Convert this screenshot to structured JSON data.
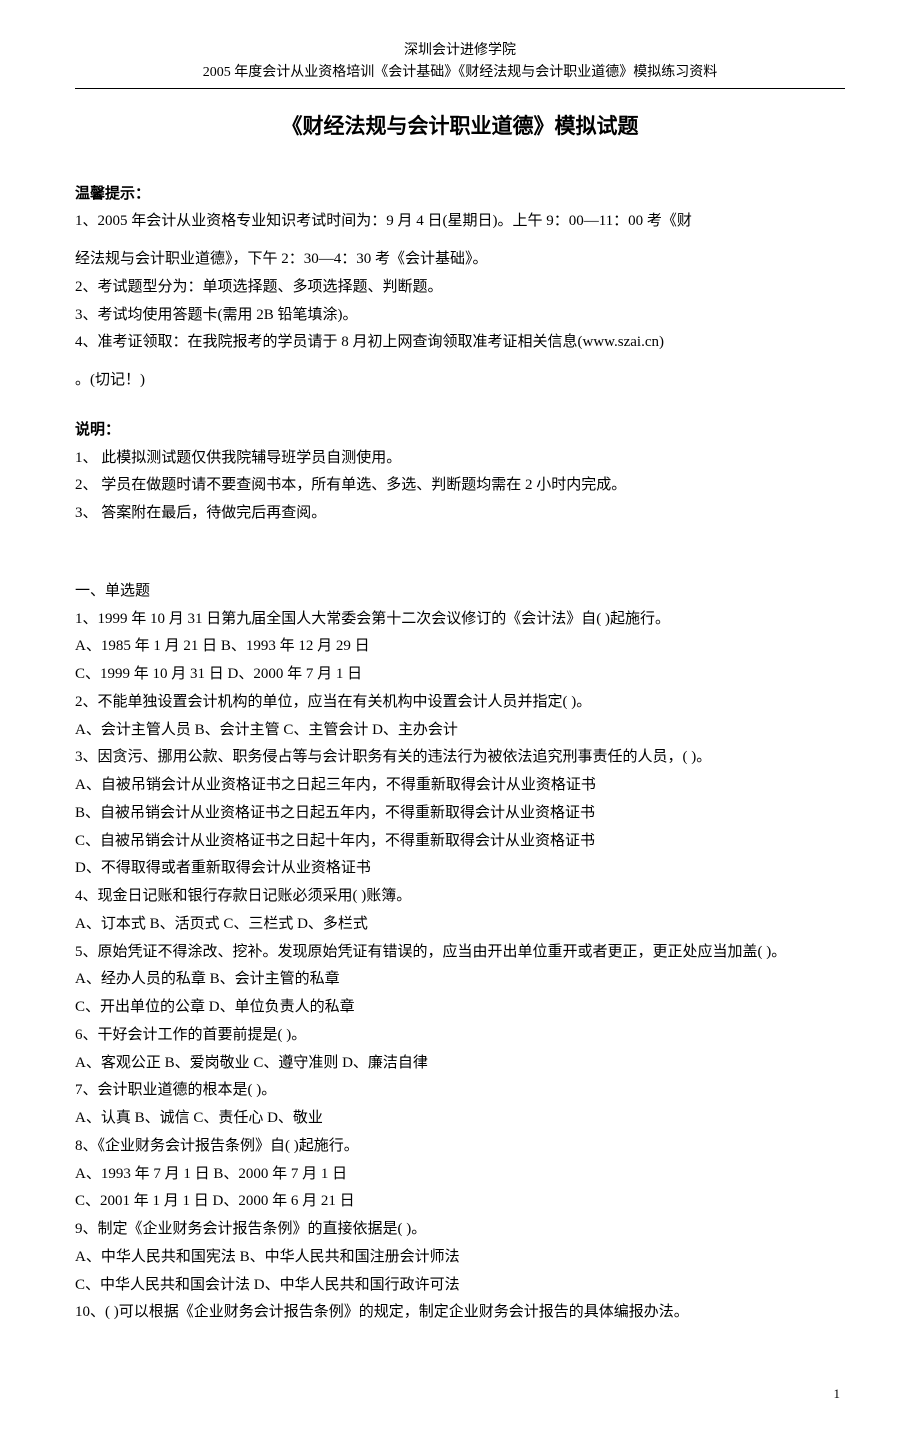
{
  "header": {
    "line1": "深圳会计进修学院",
    "line2": "2005 年度会计从业资格培训《会计基础》《财经法规与会计职业道德》模拟练习资料"
  },
  "title": "《财经法规与会计职业道德》模拟试题",
  "tips": {
    "header": "温馨提示：",
    "items": [
      "1、2005 年会计从业资格专业知识考试时间为：9 月 4 日(星期日)。上午 9：00—11：00 考《财",
      "经法规与会计职业道德》，下午 2：30—4：30 考《会计基础》。",
      "2、考试题型分为：单项选择题、多项选择题、判断题。",
      "3、考试均使用答题卡(需用 2B 铅笔填涂)。",
      "4、准考证领取：在我院报考的学员请于 8 月初上网查询领取准考证相关信息(www.szai.cn)",
      "。(切记！)"
    ]
  },
  "notes": {
    "header": "说明：",
    "items": [
      "1、  此模拟测试题仅供我院辅导班学员自测使用。",
      "2、  学员在做题时请不要查阅书本，所有单选、多选、判断题均需在 2 小时内完成。",
      "3、  答案附在最后，待做完后再查阅。"
    ]
  },
  "section1": {
    "header": "一、单选题",
    "lines": [
      "1、1999 年 10 月 31 日第九届全国人大常委会第十二次会议修订的《会计法》自(      )起施行。",
      " A、1985 年 1 月 21 日                    B、1993 年 12 月 29 日",
      " C、1999 年 10 月 31 日          D、2000 年 7 月 1 日",
      " 2、不能单独设置会计机构的单位，应当在有关机构中设置会计人员并指定(      )。",
      " A、会计主管人员        B、会计主管        C、主管会计        D、主办会计",
      " 3、因贪污、挪用公款、职务侵占等与会计职务有关的违法行为被依法追究刑事责任的人员，(      )。",
      " A、自被吊销会计从业资格证书之日起三年内，不得重新取得会计从业资格证书",
      " B、自被吊销会计从业资格证书之日起五年内，不得重新取得会计从业资格证书",
      " C、自被吊销会计从业资格证书之日起十年内，不得重新取得会计从业资格证书",
      " D、不得取得或者重新取得会计从业资格证书",
      " 4、现金日记账和银行存款日记账必须采用(      )账簿。",
      " A、订本式          B、活页式          C、三栏式          D、多栏式",
      " 5、原始凭证不得涂改、挖补。发现原始凭证有错误的，应当由开出单位重开或者更正，更正处应当加盖(      )。",
      " A、经办人员的私章          B、会计主管的私章",
      " C、开出单位的公章          D、单位负责人的私章",
      " 6、干好会计工作的首要前提是(      )。",
      " A、客观公正        B、爱岗敬业        C、遵守准则        D、廉洁自律",
      " 7、会计职业道德的根本是(      )。",
      " A、认真            B、诚信              C、责任心        D、敬业",
      " 8、《企业财务会计报告条例》自(      )起施行。",
      " A、1993 年 7 月 1 日            B、2000 年 7 月 1 日",
      " C、2001 年 1 月 1 日        D、2000 年 6 月 21 日",
      " 9、制定《企业财务会计报告条例》的直接依据是(      )。",
      " A、中华人民共和国宪法        B、中华人民共和国注册会计师法",
      " C、中华人民共和国会计法      D、中华人民共和国行政许可法",
      " 10、(      )可以根据《企业财务会计报告条例》的规定，制定企业财务会计报告的具体编报办法。"
    ]
  },
  "page_number": "1"
}
